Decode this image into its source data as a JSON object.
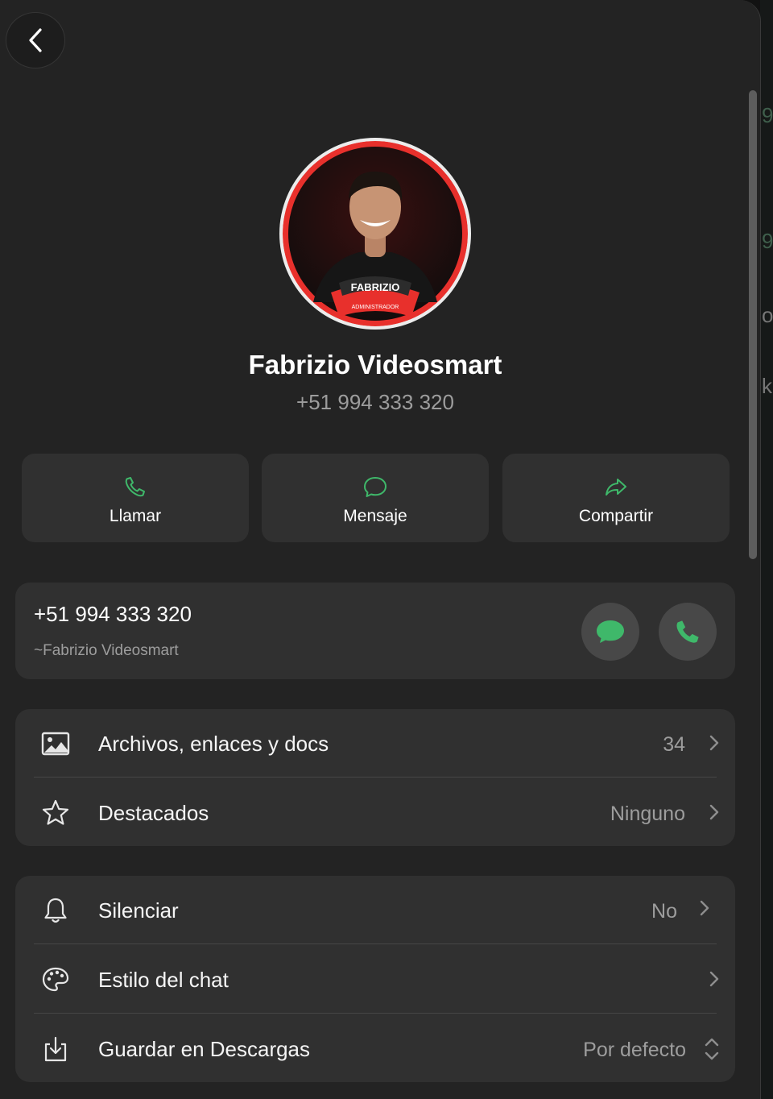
{
  "contact": {
    "name": "Fabrizio Videosmart",
    "phone": "+51 994 333 320",
    "avatar_badge": "FABRIZIO",
    "avatar_role": "ADMINISTRADOR"
  },
  "actions": [
    {
      "label": "Llamar",
      "icon": "phone-icon"
    },
    {
      "label": "Mensaje",
      "icon": "message-icon"
    },
    {
      "label": "Compartir",
      "icon": "share-icon"
    }
  ],
  "number_card": {
    "phone": "+51 994 333 320",
    "alias": "~Fabrizio Videosmart"
  },
  "media_section": [
    {
      "label": "Archivos, enlaces y docs",
      "value": "34",
      "icon": "image-icon"
    },
    {
      "label": "Destacados",
      "value": "Ninguno",
      "icon": "star-icon"
    }
  ],
  "settings_section": [
    {
      "label": "Silenciar",
      "value": "No",
      "icon": "bell-icon"
    },
    {
      "label": "Estilo del chat",
      "value": "",
      "icon": "palette-icon"
    },
    {
      "label": "Guardar en Descargas",
      "value": "Por defecto",
      "icon": "download-icon"
    }
  ],
  "colors": {
    "accent": "#3fb86a",
    "panel": "#232323",
    "card": "#303030",
    "avatar_ring": "#e8302c"
  }
}
